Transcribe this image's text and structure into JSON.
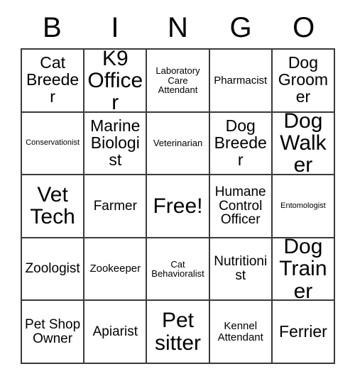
{
  "card": {
    "headers": [
      "B",
      "I",
      "N",
      "G",
      "O"
    ],
    "rows": [
      [
        {
          "label": "Cat Breeder",
          "size": "lg"
        },
        {
          "label": "K9 Officer",
          "size": "xl"
        },
        {
          "label": "Laboratory Care Attendant",
          "size": "xs"
        },
        {
          "label": "Pharmacist",
          "size": "sm"
        },
        {
          "label": "Dog Groomer",
          "size": "lg"
        }
      ],
      [
        {
          "label": "Conservationist",
          "size": "xxs"
        },
        {
          "label": "Marine Biologist",
          "size": "lg"
        },
        {
          "label": "Veterinarian",
          "size": "xs"
        },
        {
          "label": "Dog Breeder",
          "size": "lg"
        },
        {
          "label": "Dog Walker",
          "size": "xl"
        }
      ],
      [
        {
          "label": "Vet Tech",
          "size": "xl"
        },
        {
          "label": "Farmer",
          "size": "md"
        },
        {
          "label": "Free!",
          "size": "xl"
        },
        {
          "label": "Humane Control Officer",
          "size": "md"
        },
        {
          "label": "Entomologist",
          "size": "xxs"
        }
      ],
      [
        {
          "label": "Zoologist",
          "size": "md"
        },
        {
          "label": "Zookeeper",
          "size": "sm"
        },
        {
          "label": "Cat Behavioralist",
          "size": "xs"
        },
        {
          "label": "Nutritionist",
          "size": "md"
        },
        {
          "label": "Dog Trainer",
          "size": "xl"
        }
      ],
      [
        {
          "label": "Pet Shop Owner",
          "size": "md"
        },
        {
          "label": "Apiarist",
          "size": "md"
        },
        {
          "label": "Pet sitter",
          "size": "xl"
        },
        {
          "label": "Kennel Attendant",
          "size": "sm"
        },
        {
          "label": "Ferrier",
          "size": "lg"
        }
      ]
    ]
  },
  "colors": {
    "border": "#3a3a3a",
    "text": "#000000",
    "background": "#ffffff"
  }
}
